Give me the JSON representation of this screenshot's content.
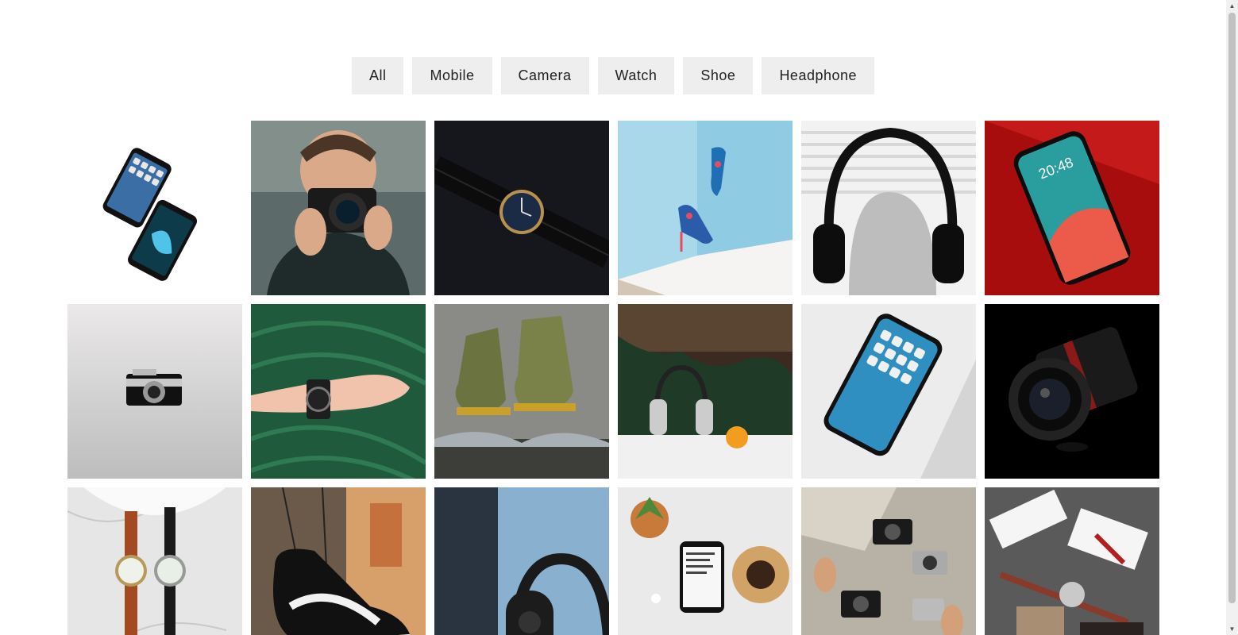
{
  "filters": [
    {
      "label": "All"
    },
    {
      "label": "Mobile"
    },
    {
      "label": "Camera"
    },
    {
      "label": "Watch"
    },
    {
      "label": "Shoe"
    },
    {
      "label": "Headphone"
    }
  ],
  "gallery": [
    {
      "category": "mobile",
      "icon": "phone-pair-icon"
    },
    {
      "category": "camera",
      "icon": "camera-person-icon"
    },
    {
      "category": "watch",
      "icon": "watch-icon"
    },
    {
      "category": "shoe",
      "icon": "high-heel-icon"
    },
    {
      "category": "headphone",
      "icon": "headphone-icon"
    },
    {
      "category": "mobile",
      "icon": "phone-icon"
    },
    {
      "category": "camera",
      "icon": "camera-icon"
    },
    {
      "category": "watch",
      "icon": "watch-wrist-icon"
    },
    {
      "category": "shoe",
      "icon": "boots-icon"
    },
    {
      "category": "headphone",
      "icon": "headphone-icon"
    },
    {
      "category": "mobile",
      "icon": "phone-icon"
    },
    {
      "category": "camera",
      "icon": "lens-icon"
    },
    {
      "category": "watch",
      "icon": "watches-icon"
    },
    {
      "category": "shoe",
      "icon": "sneaker-icon"
    },
    {
      "category": "headphone",
      "icon": "headphone-icon"
    },
    {
      "category": "mobile",
      "icon": "phone-desk-icon"
    },
    {
      "category": "camera",
      "icon": "cameras-icon"
    },
    {
      "category": "watch",
      "icon": "watch-gift-icon"
    }
  ]
}
